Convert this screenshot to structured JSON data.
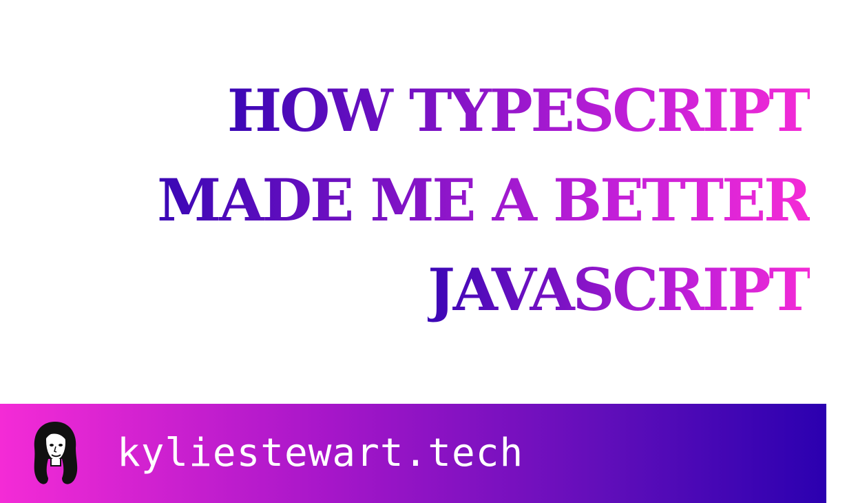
{
  "title": {
    "lines": [
      "HOW TYPESCRIPT",
      "MADE ME A BETTER",
      "JAVASCRIPT"
    ]
  },
  "footer": {
    "site_url": "kyliestewart.tech",
    "avatar_icon": "woman-portrait-illustration"
  },
  "colors": {
    "gradient_purple": "#3a07b5",
    "gradient_pink": "#f42bd6",
    "bar_blue": "#2b00b0",
    "text_white": "#ffffff"
  }
}
